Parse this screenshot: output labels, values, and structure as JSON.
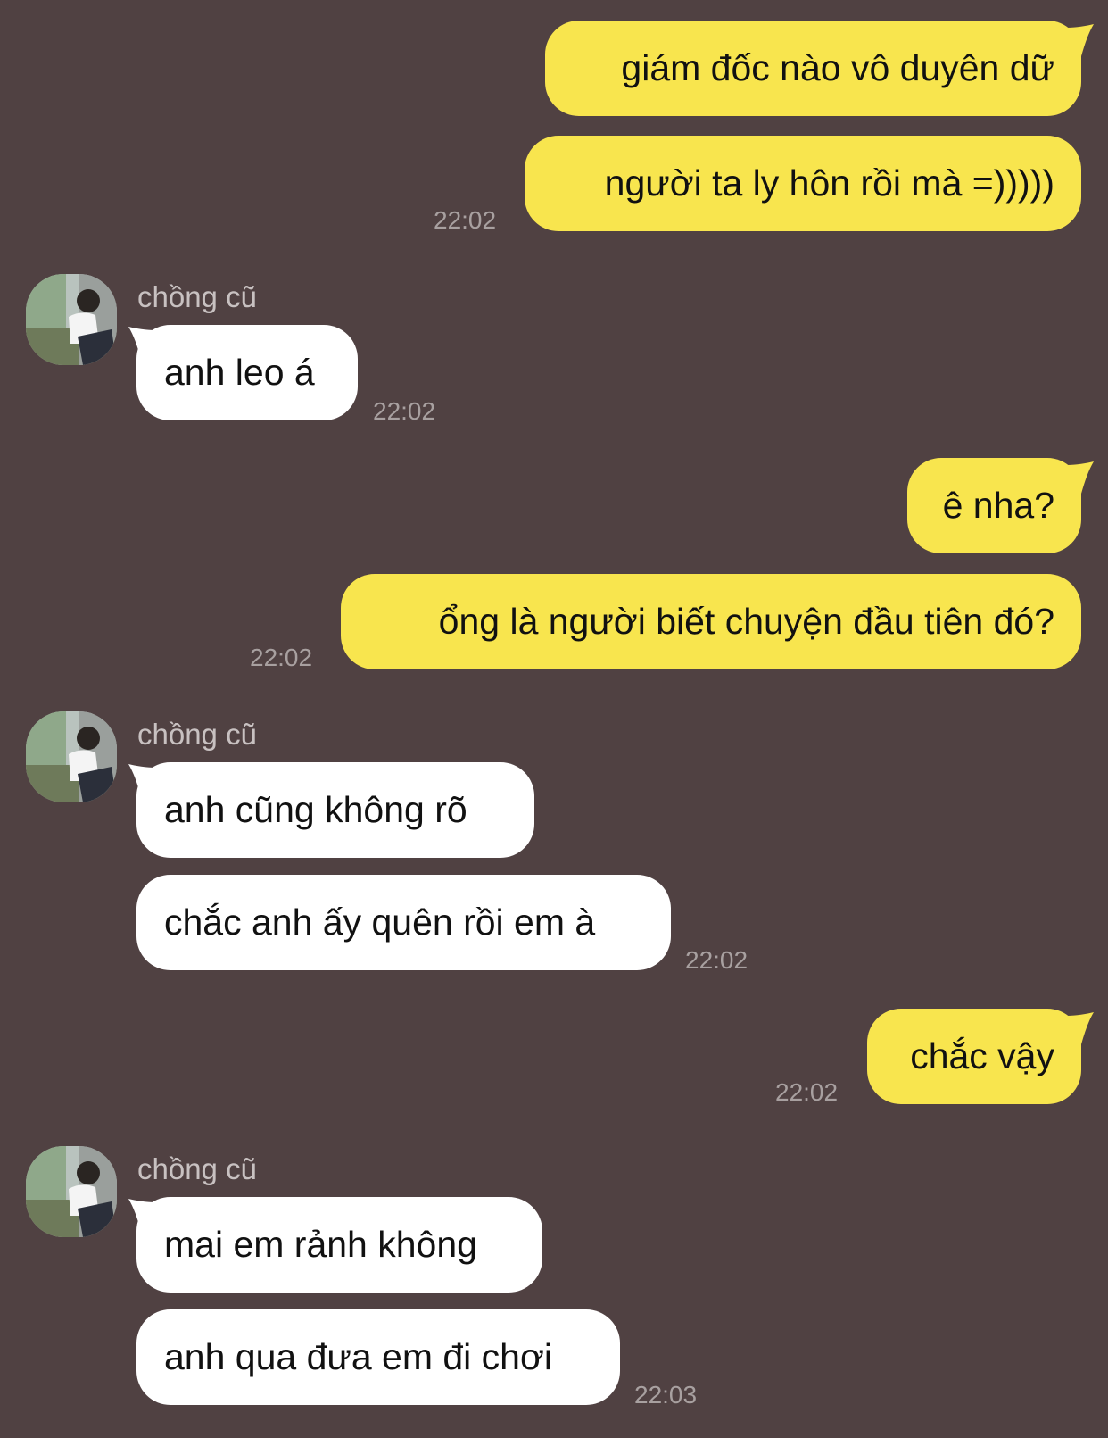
{
  "colors": {
    "background": "#504142",
    "outgoing_bubble": "#F8E54E",
    "incoming_bubble": "#FFFFFF",
    "timestamp": "#A8A0A0",
    "sender_name": "#C8C1C1"
  },
  "chat": {
    "contact_name": "chồng cũ",
    "avatar_icon": "profile-photo-icon",
    "messages": [
      {
        "from": "me",
        "text": "giám đốc nào vô duyên dữ"
      },
      {
        "from": "me",
        "text": "người ta ly hôn rồi mà =)))))",
        "time": "22:02"
      },
      {
        "from": "contact",
        "text": "anh leo á",
        "time": "22:02"
      },
      {
        "from": "me",
        "text": "ê nha?"
      },
      {
        "from": "me",
        "text": "ổng là người biết chuyện đầu tiên đó?",
        "time": "22:02"
      },
      {
        "from": "contact",
        "text": "anh cũng không rõ"
      },
      {
        "from": "contact",
        "text": "chắc anh ấy quên rồi em à",
        "time": "22:02"
      },
      {
        "from": "me",
        "text": "chắc vậy",
        "time": "22:02"
      },
      {
        "from": "contact",
        "text": "mai em rảnh không"
      },
      {
        "from": "contact",
        "text": "anh qua đưa em đi chơi",
        "time": "22:03"
      }
    ]
  }
}
